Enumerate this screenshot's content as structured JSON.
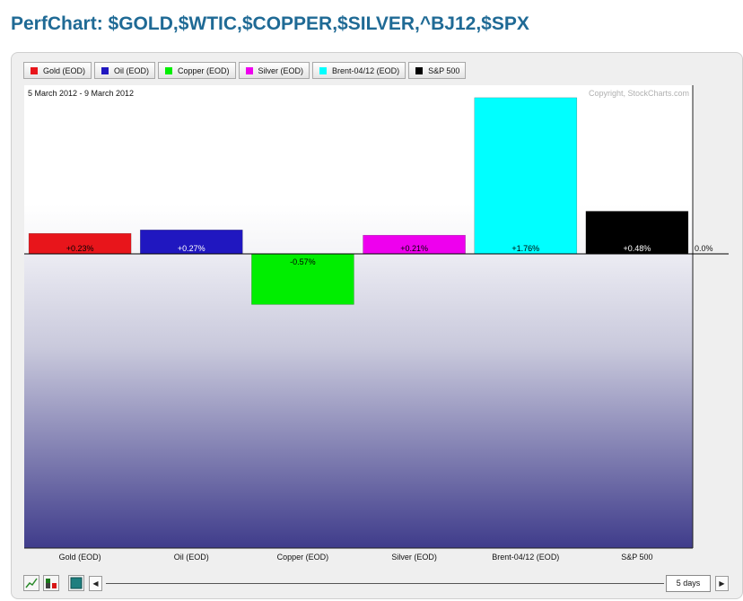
{
  "page": {
    "title": "PerfChart: $GOLD,$WTIC,$COPPER,$SILVER,^BJ12,$SPX"
  },
  "legend": [
    {
      "label": "Gold (EOD)",
      "color": "#e8151b"
    },
    {
      "label": "Oil (EOD)",
      "color": "#2017c0"
    },
    {
      "label": "Copper (EOD)",
      "color": "#00ee00"
    },
    {
      "label": "Silver (EOD)",
      "color": "#ee00ee"
    },
    {
      "label": "Brent-04/12 (EOD)",
      "color": "#00ffff"
    },
    {
      "label": "S&P 500",
      "color": "#000000"
    }
  ],
  "chart_data": {
    "type": "bar",
    "date_range": "5 March 2012 - 9 March 2012",
    "copyright": "Copyright, StockCharts.com",
    "categories": [
      "Gold (EOD)",
      "Oil (EOD)",
      "Copper (EOD)",
      "Silver (EOD)",
      "Brent-04/12 (EOD)",
      "S&P 500"
    ],
    "values": [
      0.23,
      0.27,
      -0.57,
      0.21,
      1.76,
      0.48
    ],
    "value_labels": [
      "+0.23%",
      "+0.27%",
      "-0.57%",
      "+0.21%",
      "+1.76%",
      "+0.48%"
    ],
    "colors": [
      "#e8151b",
      "#2017c0",
      "#00ee00",
      "#ee00ee",
      "#00ffff",
      "#000000"
    ],
    "label_colors": [
      "#000000",
      "#ffffff",
      "#000000",
      "#000000",
      "#000000",
      "#ffffff"
    ],
    "zero_label": "0.0%",
    "ylim": [
      -3.5,
      1.9
    ]
  },
  "controls": {
    "period": "5 days"
  },
  "icons": [
    "line-chart-icon",
    "bar-chart-icon",
    "fill-icon",
    "scroll-left-icon",
    "scroll-right-icon"
  ]
}
